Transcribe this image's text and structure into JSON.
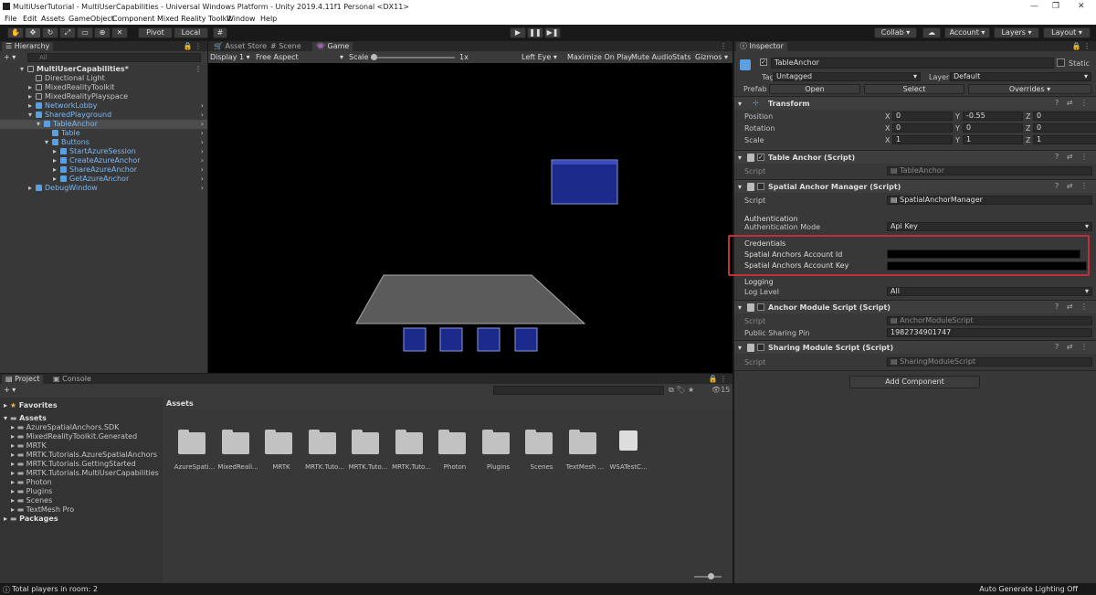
{
  "titlebar": {
    "title": "MultiUserTutorial - MultiUserCapabilities - Universal Windows Platform - Unity 2019.4.11f1 Personal <DX11>"
  },
  "menu": [
    "File",
    "Edit",
    "Assets",
    "GameObject",
    "Component",
    "Mixed Reality Toolkit",
    "Window",
    "Help"
  ],
  "toolbar": {
    "pivot": "Pivot",
    "local": "Local",
    "collab": "Collab",
    "account": "Account",
    "layers": "Layers",
    "layout": "Layout"
  },
  "hierarchy": {
    "tab": "Hierarchy",
    "search_placeholder": "All",
    "items": [
      {
        "label": "MultiUserCapabilities*",
        "depth": 0,
        "kind": "scene"
      },
      {
        "label": "Directional Light",
        "depth": 1,
        "kind": "go"
      },
      {
        "label": "MixedRealityToolkit",
        "depth": 1,
        "kind": "go"
      },
      {
        "label": "MixedRealityPlayspace",
        "depth": 1,
        "kind": "go"
      },
      {
        "label": "NetworkLobby",
        "depth": 1,
        "kind": "prefab"
      },
      {
        "label": "SharedPlayground",
        "depth": 1,
        "kind": "prefab"
      },
      {
        "label": "TableAnchor",
        "depth": 2,
        "kind": "prefab",
        "selected": true
      },
      {
        "label": "Table",
        "depth": 3,
        "kind": "prefab"
      },
      {
        "label": "Buttons",
        "depth": 3,
        "kind": "prefab"
      },
      {
        "label": "StartAzureSession",
        "depth": 4,
        "kind": "prefab"
      },
      {
        "label": "CreateAzureAnchor",
        "depth": 4,
        "kind": "prefab"
      },
      {
        "label": "ShareAzureAnchor",
        "depth": 4,
        "kind": "prefab"
      },
      {
        "label": "GetAzureAnchor",
        "depth": 4,
        "kind": "prefab"
      },
      {
        "label": "DebugWindow",
        "depth": 1,
        "kind": "prefab"
      }
    ]
  },
  "game": {
    "tabs": [
      "Asset Store",
      "Scene",
      "Game"
    ],
    "display": "Display 1",
    "aspect": "Free Aspect",
    "scale_label": "Scale",
    "scale_value": "1x",
    "options": [
      "Left Eye",
      "Maximize On Play",
      "Mute Audio",
      "Stats",
      "Gizmos"
    ]
  },
  "inspector": {
    "tab": "Inspector",
    "object_name": "TableAnchor",
    "static_label": "Static",
    "tag_label": "Tag",
    "tag_value": "Untagged",
    "layer_label": "Layer",
    "layer_value": "Default",
    "prefab_label": "Prefab",
    "open_label": "Open",
    "select_label": "Select",
    "overrides_label": "Overrides",
    "transform": {
      "title": "Transform",
      "rows": [
        {
          "label": "Position",
          "x": "0",
          "y": "-0.55",
          "z": "0"
        },
        {
          "label": "Rotation",
          "x": "0",
          "y": "0",
          "z": "0"
        },
        {
          "label": "Scale",
          "x": "1",
          "y": "1",
          "z": "1"
        }
      ]
    },
    "table_anchor": {
      "title": "Table Anchor (Script)",
      "script_label": "Script",
      "script_value": "TableAnchor"
    },
    "spatial_manager": {
      "title": "Spatial Anchor Manager (Script)",
      "script_label": "Script",
      "script_value": "SpatialAnchorManager",
      "auth_header": "Authentication",
      "auth_mode_label": "Authentication Mode",
      "auth_mode_value": "Api Key",
      "cred_header": "Credentials",
      "account_id_label": "Spatial Anchors Account Id",
      "account_key_label": "Spatial Anchors Account Key",
      "logging_header": "Logging",
      "log_level_label": "Log Level",
      "log_level_value": "All"
    },
    "anchor_module": {
      "title": "Anchor Module Script (Script)",
      "script_label": "Script",
      "script_value": "AnchorModuleScript",
      "pin_label": "Public Sharing Pin",
      "pin_value": "1982734901747"
    },
    "sharing_module": {
      "title": "Sharing Module Script (Script)",
      "script_label": "Script",
      "script_value": "SharingModuleScript"
    },
    "add_component": "Add Component",
    "highlight_color": "#c0303a"
  },
  "project": {
    "tabs": [
      "Project",
      "Console"
    ],
    "favorites": "Favorites",
    "assets_root": "Assets",
    "tree": [
      "AzureSpatialAnchors.SDK",
      "MixedRealityToolkit.Generated",
      "MRTK",
      "MRTK.Tutorials.AzureSpatialAnchors",
      "MRTK.Tutorials.GettingStarted",
      "MRTK.Tutorials.MultiUserCapabilities",
      "Photon",
      "Plugins",
      "Scenes",
      "TextMesh Pro"
    ],
    "packages": "Packages",
    "breadcrumb": "Assets",
    "count": "15",
    "files": [
      "AzureSpati...",
      "MixedReali...",
      "MRTK",
      "MRTK.Tuto...",
      "MRTK.Tuto...",
      "MRTK.Tuto...",
      "Photon",
      "Plugins",
      "Scenes",
      "TextMesh ...",
      "WSATestC..."
    ]
  },
  "status": {
    "left": "Total players in room: 2",
    "right": "Auto Generate Lighting Off"
  }
}
